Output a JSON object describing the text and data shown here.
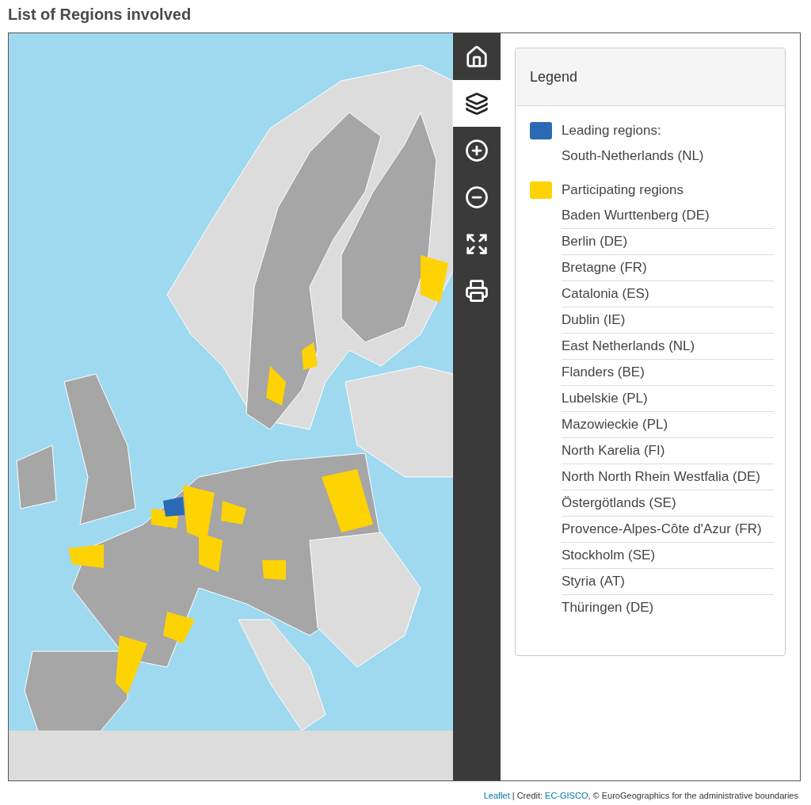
{
  "title": "List of Regions involved",
  "map_toolbar": [
    {
      "kind": "home",
      "selected": false
    },
    {
      "kind": "layers",
      "selected": true
    },
    {
      "kind": "zoom-in",
      "selected": false
    },
    {
      "kind": "zoom-out",
      "selected": false
    },
    {
      "kind": "fullscreen",
      "selected": false
    },
    {
      "kind": "print",
      "selected": false
    }
  ],
  "legend": {
    "title": "Legend",
    "groups": [
      {
        "label": "Leading regions:",
        "color": "#2a6ab5",
        "regions": [
          "South-Netherlands (NL)"
        ]
      },
      {
        "label": "Participating regions",
        "color": "#fed304",
        "regions": [
          "Baden Wurttenberg (DE)",
          "Berlin (DE)",
          "Bretagne (FR)",
          "Catalonia (ES)",
          "Dublin (IE)",
          "East Netherlands (NL)",
          "Flanders (BE)",
          "Lubelskie (PL)",
          "Mazowieckie (PL)",
          "North Karelia (FI)",
          "North North Rhein Westfalia (DE)",
          "Östergötlands (SE)",
          "Provence-Alpes-Côte d'Azur (FR)",
          "Stockholm (SE)",
          "Styria (AT)",
          "Thüringen (DE)"
        ]
      }
    ]
  },
  "attribution": {
    "library_link": "Leaflet",
    "credit_label": "| Credit:",
    "credit_link": "EC-GISCO",
    "rest": ", © EuroGeographics for the administrative boundaries"
  }
}
